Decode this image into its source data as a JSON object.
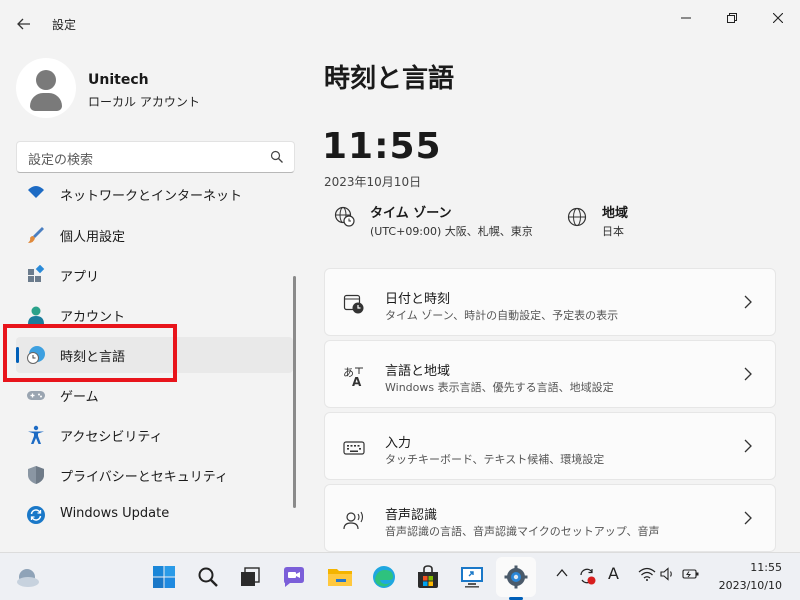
{
  "window": {
    "title": "設定",
    "controls": {
      "minimize": "minimize-icon",
      "maximize": "restore-icon",
      "close": "close-icon"
    }
  },
  "profile": {
    "name": "Unitech",
    "account_type": "ローカル アカウント"
  },
  "search": {
    "placeholder": "設定の検索"
  },
  "sidebar": {
    "items": [
      {
        "label": "ネットワークとインターネット",
        "icon": "network-icon"
      },
      {
        "label": "個人用設定",
        "icon": "brush-icon"
      },
      {
        "label": "アプリ",
        "icon": "apps-icon"
      },
      {
        "label": "アカウント",
        "icon": "account-icon"
      },
      {
        "label": "時刻と言語",
        "icon": "time-language-icon",
        "selected": true
      },
      {
        "label": "ゲーム",
        "icon": "gamepad-icon"
      },
      {
        "label": "アクセシビリティ",
        "icon": "accessibility-icon"
      },
      {
        "label": "プライバシーとセキュリティ",
        "icon": "shield-icon"
      },
      {
        "label": "Windows Update",
        "icon": "windows-update-icon"
      }
    ]
  },
  "main": {
    "title": "時刻と言語",
    "time": "11:55",
    "date": "2023年10月10日",
    "timezone": {
      "title": "タイム ゾーン",
      "value": "(UTC+09:00) 大阪、札幌、東京"
    },
    "region": {
      "title": "地域",
      "value": "日本"
    },
    "cards": [
      {
        "title": "日付と時刻",
        "subtitle": "タイム ゾーン、時計の自動設定、予定表の表示",
        "icon": "calendar-clock-icon"
      },
      {
        "title": "言語と地域",
        "subtitle": "Windows 表示言語、優先する言語、地域設定",
        "icon": "language-icon"
      },
      {
        "title": "入力",
        "subtitle": "タッチキーボード、テキスト候補、環境設定",
        "icon": "keyboard-icon"
      },
      {
        "title": "音声認識",
        "subtitle": "音声認識の言語、音声認識マイクのセットアップ、音声",
        "icon": "speech-icon"
      }
    ]
  },
  "taskbar": {
    "time": "11:55",
    "date": "2023/10/10",
    "ime": "A",
    "colors": {
      "accent": "#005fb8",
      "highlight": "#e8141b"
    }
  }
}
